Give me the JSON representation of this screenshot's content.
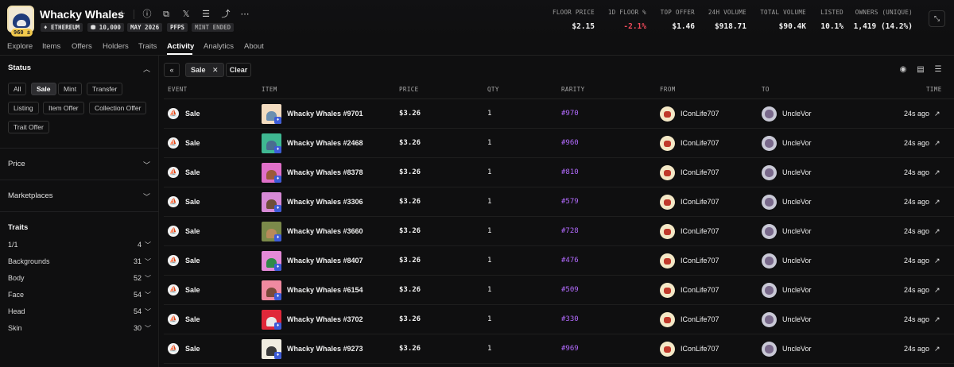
{
  "header": {
    "title": "Whacky Whales",
    "rank_badge": "960 ±",
    "chips": [
      "♦ ETHEREUM",
      "⛃ 10,000",
      "MAY 2026",
      "PFPS",
      "MINT ENDED"
    ],
    "stats": [
      {
        "label": "FLOOR PRICE",
        "value": "$2.15"
      },
      {
        "label": "1D FLOOR %",
        "value": "-2.1%"
      },
      {
        "label": "TOP OFFER",
        "value": "$1.46"
      },
      {
        "label": "24H VOLUME",
        "value": "$918.71"
      },
      {
        "label": "TOTAL VOLUME",
        "value": "$90.4K"
      },
      {
        "label": "LISTED",
        "value": "10.1%"
      },
      {
        "label": "OWNERS (UNIQUE)",
        "value": "1,419 (14.2%)"
      }
    ],
    "icons": [
      "star-icon",
      "info-icon",
      "copy-icon",
      "x-icon",
      "menu-icon",
      "share-icon",
      "more-icon",
      "collapse-icon"
    ]
  },
  "nav": {
    "tabs": [
      "Explore",
      "Items",
      "Offers",
      "Holders",
      "Traits",
      "Activity",
      "Analytics",
      "About"
    ],
    "active": "Activity"
  },
  "sidebar": {
    "status_title": "Status",
    "status_filters": [
      "All",
      "Sale",
      "Mint",
      "Transfer",
      "Listing",
      "Item Offer",
      "Collection Offer",
      "Trait Offer"
    ],
    "active_filter": "Sale",
    "price_label": "Price",
    "marketplaces_label": "Marketplaces",
    "traits_title": "Traits",
    "traits": [
      {
        "name": "1/1",
        "count": "4"
      },
      {
        "name": "Backgrounds",
        "count": "31"
      },
      {
        "name": "Body",
        "count": "52"
      },
      {
        "name": "Face",
        "count": "54"
      },
      {
        "name": "Head",
        "count": "54"
      },
      {
        "name": "Skin",
        "count": "30"
      }
    ]
  },
  "toolbar": {
    "active_chip": "Sale",
    "clear_label": "Clear"
  },
  "table": {
    "columns": [
      "EVENT",
      "ITEM",
      "PRICE",
      "QTY",
      "RARITY",
      "FROM",
      "TO",
      "TIME"
    ],
    "rows": [
      {
        "event": "Sale",
        "item": "Whacky Whales #9701",
        "price": "$3.26",
        "qty": "1",
        "rarity": "#970",
        "from": "IConLife707",
        "to": "UncleVor",
        "time": "24s ago",
        "thumb_bg": "#f3dcc0",
        "thumb_body": "#6b8fb0"
      },
      {
        "event": "Sale",
        "item": "Whacky Whales #2468",
        "price": "$3.26",
        "qty": "1",
        "rarity": "#960",
        "from": "IConLife707",
        "to": "UncleVor",
        "time": "24s ago",
        "thumb_bg": "#3fb892",
        "thumb_body": "#4a6d8f"
      },
      {
        "event": "Sale",
        "item": "Whacky Whales #8378",
        "price": "$3.26",
        "qty": "1",
        "rarity": "#810",
        "from": "IConLife707",
        "to": "UncleVor",
        "time": "24s ago",
        "thumb_bg": "#e070c8",
        "thumb_body": "#9c5a3a"
      },
      {
        "event": "Sale",
        "item": "Whacky Whales #3306",
        "price": "$3.26",
        "qty": "1",
        "rarity": "#579",
        "from": "IConLife707",
        "to": "UncleVor",
        "time": "24s ago",
        "thumb_bg": "#d78ad6",
        "thumb_body": "#6e4e3a"
      },
      {
        "event": "Sale",
        "item": "Whacky Whales #3660",
        "price": "$3.26",
        "qty": "1",
        "rarity": "#728",
        "from": "IConLife707",
        "to": "UncleVor",
        "time": "24s ago",
        "thumb_bg": "#7b8a4a",
        "thumb_body": "#b88a5a"
      },
      {
        "event": "Sale",
        "item": "Whacky Whales #8407",
        "price": "$3.26",
        "qty": "1",
        "rarity": "#476",
        "from": "IConLife707",
        "to": "UncleVor",
        "time": "24s ago",
        "thumb_bg": "#e48ad8",
        "thumb_body": "#2f8a4a"
      },
      {
        "event": "Sale",
        "item": "Whacky Whales #6154",
        "price": "$3.26",
        "qty": "1",
        "rarity": "#509",
        "from": "IConLife707",
        "to": "UncleVor",
        "time": "24s ago",
        "thumb_bg": "#f08aa0",
        "thumb_body": "#7a4a3a"
      },
      {
        "event": "Sale",
        "item": "Whacky Whales #3702",
        "price": "$3.26",
        "qty": "1",
        "rarity": "#330",
        "from": "IConLife707",
        "to": "UncleVor",
        "time": "24s ago",
        "thumb_bg": "#e0283a",
        "thumb_body": "#e8e8e8"
      },
      {
        "event": "Sale",
        "item": "Whacky Whales #9273",
        "price": "$3.26",
        "qty": "1",
        "rarity": "#969",
        "from": "IConLife707",
        "to": "UncleVor",
        "time": "24s ago",
        "thumb_bg": "#f0ece0",
        "thumb_body": "#3a3a3a"
      }
    ]
  },
  "colors": {
    "accent_rarity": "#b36bff",
    "negative": "#ef4a5a",
    "background": "#0f0f10"
  }
}
